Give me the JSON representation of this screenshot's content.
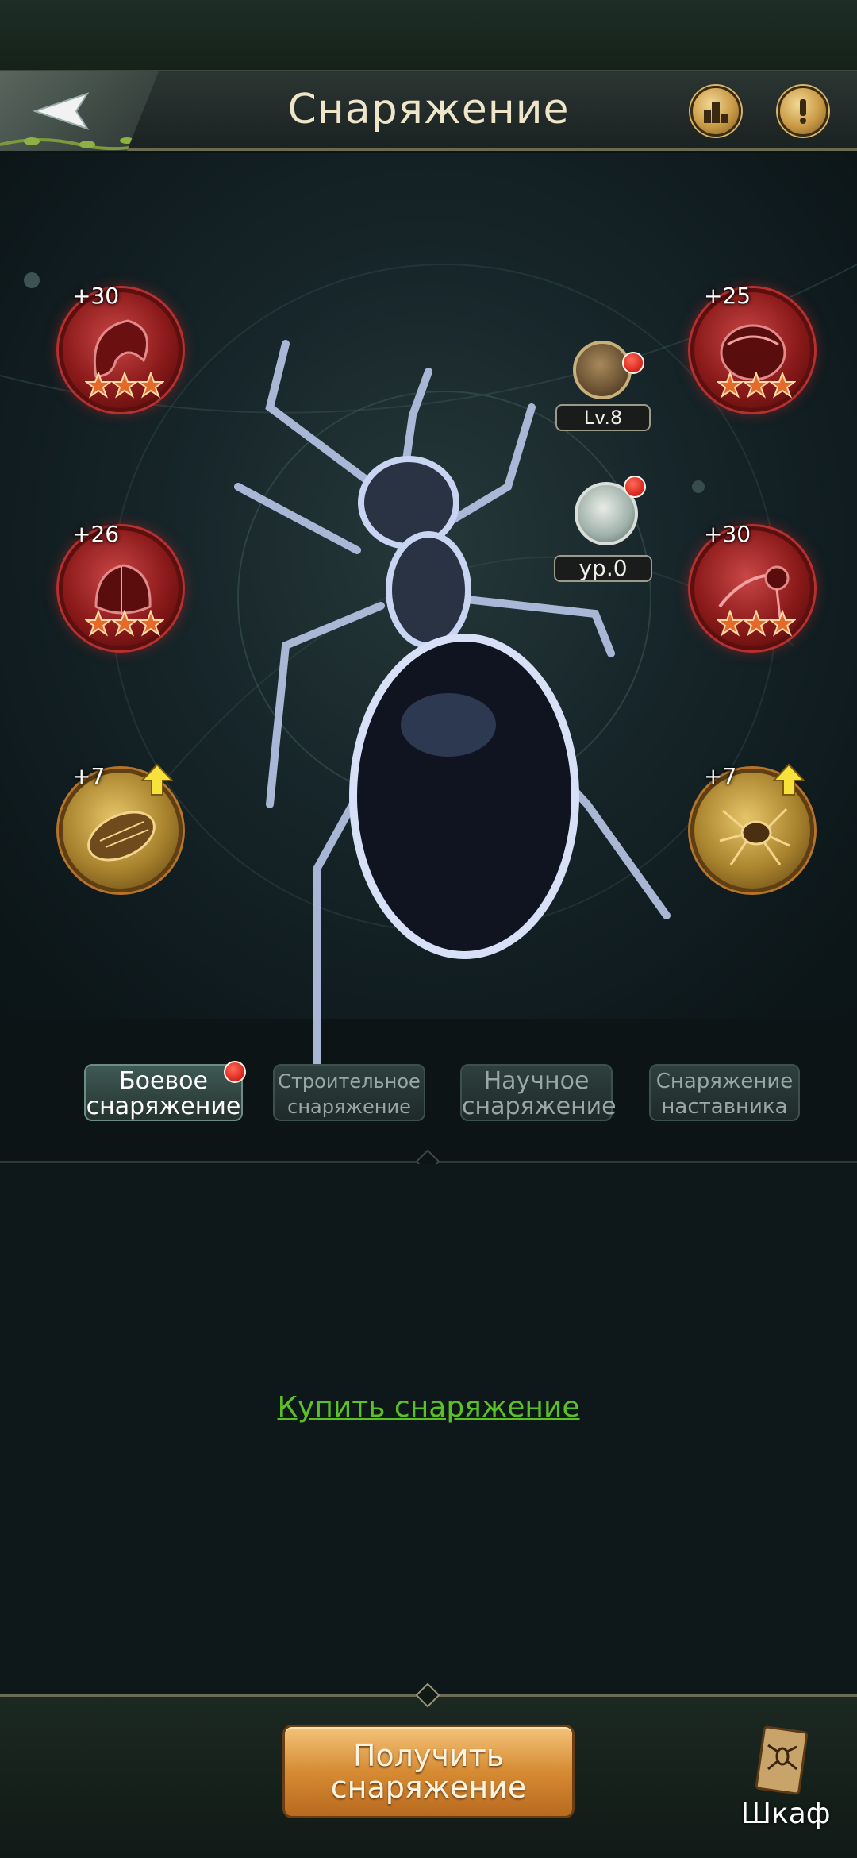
{
  "header": {
    "title": "Снаряжение",
    "back_icon": "back-arrow-icon",
    "rank_icon": "podium-icon",
    "info_icon": "exclamation-icon"
  },
  "badges": {
    "top_level": "Lv.8",
    "mentor_level": "ур.0"
  },
  "slots": [
    {
      "bonus": "+30",
      "stars": 3,
      "type": "red",
      "icon": "shell-icon"
    },
    {
      "bonus": "+25",
      "stars": 3,
      "type": "red",
      "icon": "carapace-icon"
    },
    {
      "bonus": "+26",
      "stars": 3,
      "type": "red",
      "icon": "thorax-icon"
    },
    {
      "bonus": "+30",
      "stars": 3,
      "type": "red",
      "icon": "claw-icon"
    },
    {
      "bonus": "+7",
      "stars": 0,
      "type": "gold",
      "icon": "larva-icon",
      "upgrade": true
    },
    {
      "bonus": "+7",
      "stars": 0,
      "type": "gold",
      "icon": "spider-icon",
      "upgrade": true
    }
  ],
  "tabs": [
    {
      "label_1": "Боевое",
      "label_2": "снаряжение",
      "active": true,
      "dot": true
    },
    {
      "label_1": "Строительное",
      "label_2": "снаряжение",
      "active": false
    },
    {
      "label_1": "Научное",
      "label_2": "снаряжение",
      "active": false
    },
    {
      "label_1": "Снаряжение",
      "label_2": "наставника",
      "active": false
    }
  ],
  "content": {
    "buy_link": "Купить снаряжение"
  },
  "bottom": {
    "get_button_1": "Получить",
    "get_button_2": "снаряжение",
    "wardrobe_label": "Шкаф"
  },
  "colors": {
    "accent_green": "#5bc226",
    "notification_red": "#d8231a",
    "gold": "#d68b33"
  }
}
